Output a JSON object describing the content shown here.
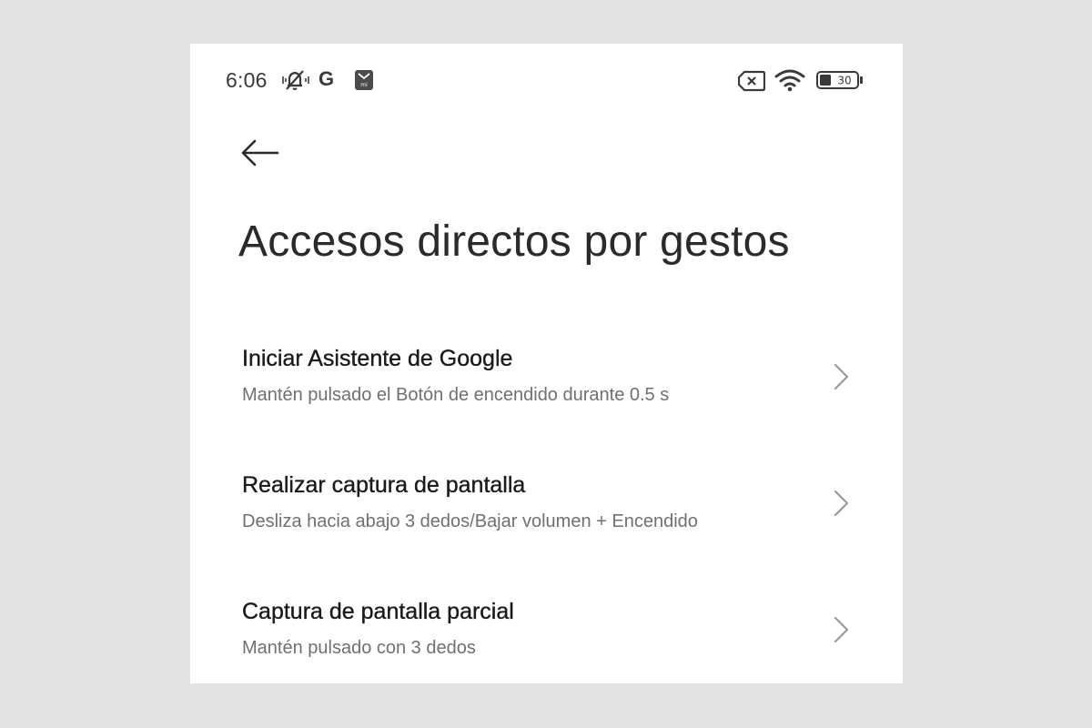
{
  "status_bar": {
    "time": "6:06",
    "g_label": "G",
    "battery_level": "30",
    "icons": [
      "do-not-disturb-icon",
      "google-icon",
      "mi-icon",
      "no-sim-icon",
      "wifi-icon",
      "battery-icon"
    ]
  },
  "header": {
    "back_icon": "arrow-left-icon",
    "title": "Accesos directos por gestos"
  },
  "items": [
    {
      "title": "Iniciar Asistente de Google",
      "subtitle": "Mantén pulsado el Botón de encendido durante 0.5 s"
    },
    {
      "title": "Realizar captura de pantalla",
      "subtitle": "Desliza hacia abajo 3 dedos/Bajar volumen + Encendido"
    },
    {
      "title": "Captura de pantalla parcial",
      "subtitle": "Mantén pulsado con 3 dedos"
    }
  ],
  "colors": {
    "background": "#e3e3e3",
    "surface": "#ffffff",
    "title_text": "#1a1a1a",
    "subtitle_text": "#707070",
    "chevron": "#9a9a9a"
  }
}
